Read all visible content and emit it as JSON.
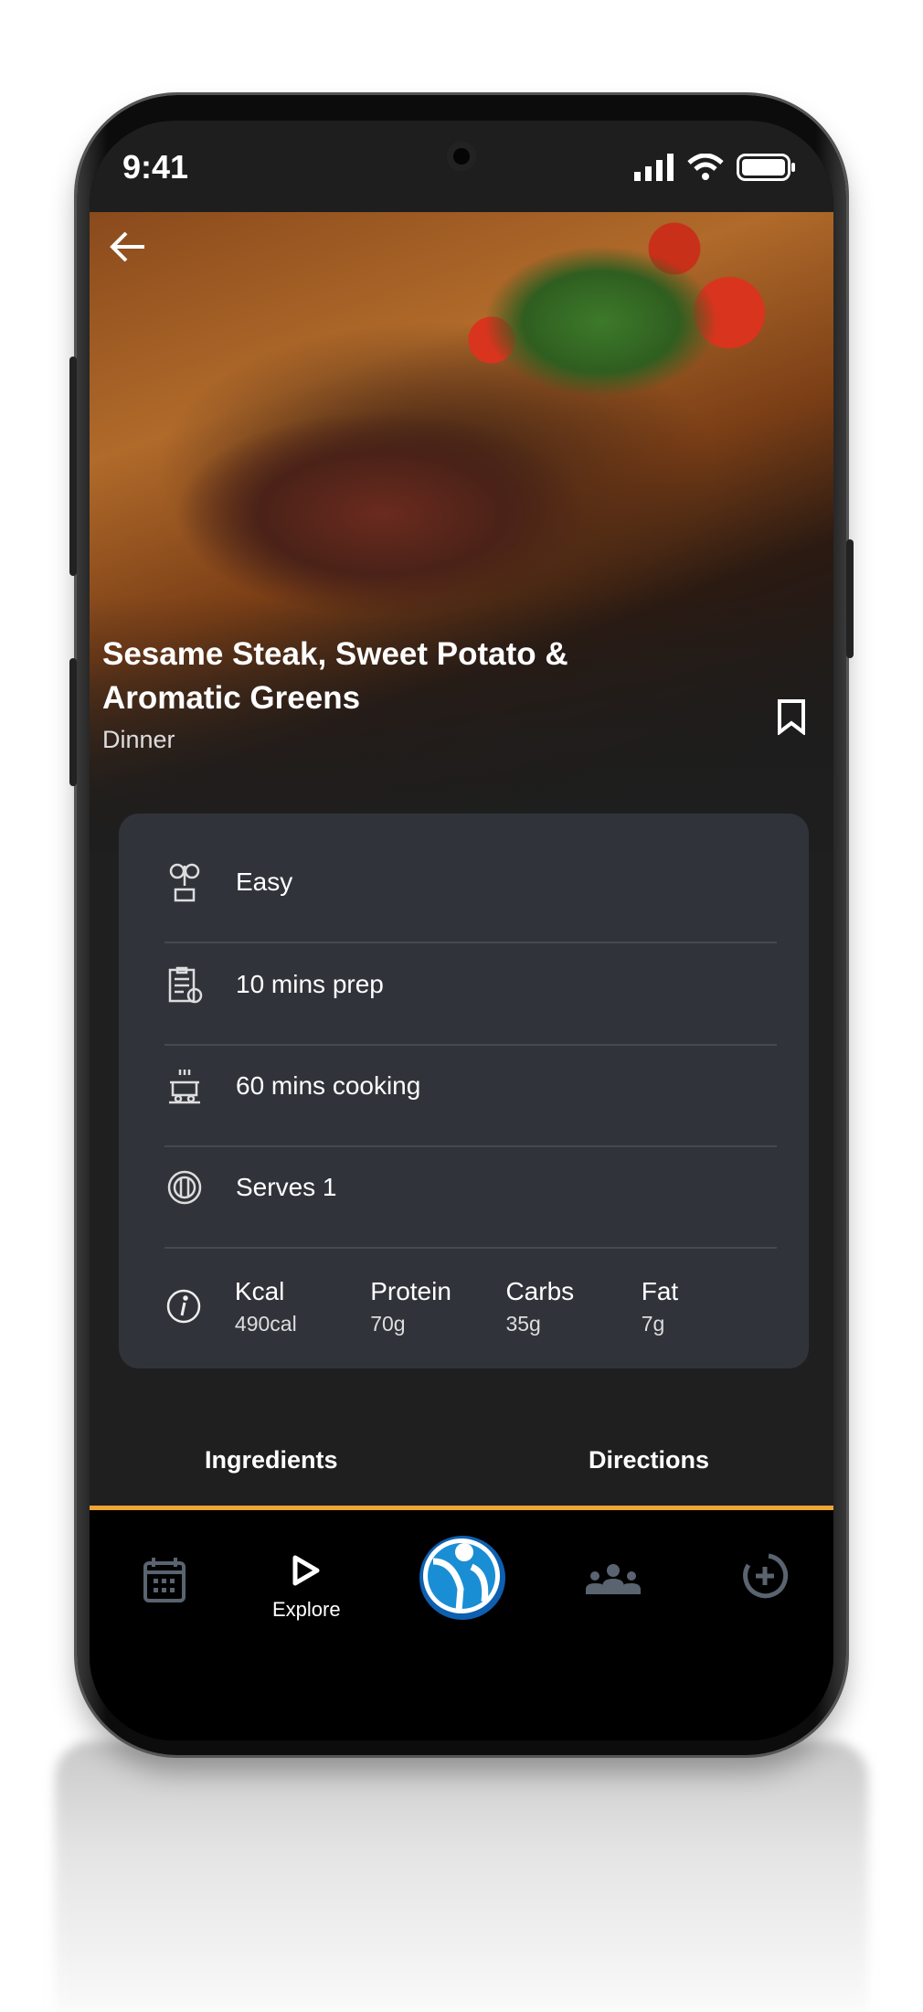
{
  "status_bar": {
    "time": "9:41"
  },
  "recipe": {
    "title": "Sesame Steak, Sweet Potato & Aromatic Greens",
    "meal": "Dinner"
  },
  "details": [
    {
      "icon": "chef-utensils-icon",
      "text": "Easy"
    },
    {
      "icon": "clipboard-prep-icon",
      "text": "10 mins prep"
    },
    {
      "icon": "cooking-pot-icon",
      "text": "60 mins cooking"
    },
    {
      "icon": "plate-cutlery-icon",
      "text": "Serves 1"
    }
  ],
  "nutrition": [
    {
      "label": "Kcal",
      "value": "490cal"
    },
    {
      "label": "Protein",
      "value": "70g"
    },
    {
      "label": "Carbs",
      "value": "35g"
    },
    {
      "label": "Fat",
      "value": "7g"
    }
  ],
  "tabs": {
    "ingredients": "Ingredients",
    "directions": "Directions"
  },
  "nav": {
    "explore": "Explore"
  },
  "colors": {
    "accent": "#f0a436",
    "card": "#30343a",
    "background": "#1f1f1f",
    "logo": "#1a73c6",
    "nav_icon_inactive": "#5a6470"
  }
}
